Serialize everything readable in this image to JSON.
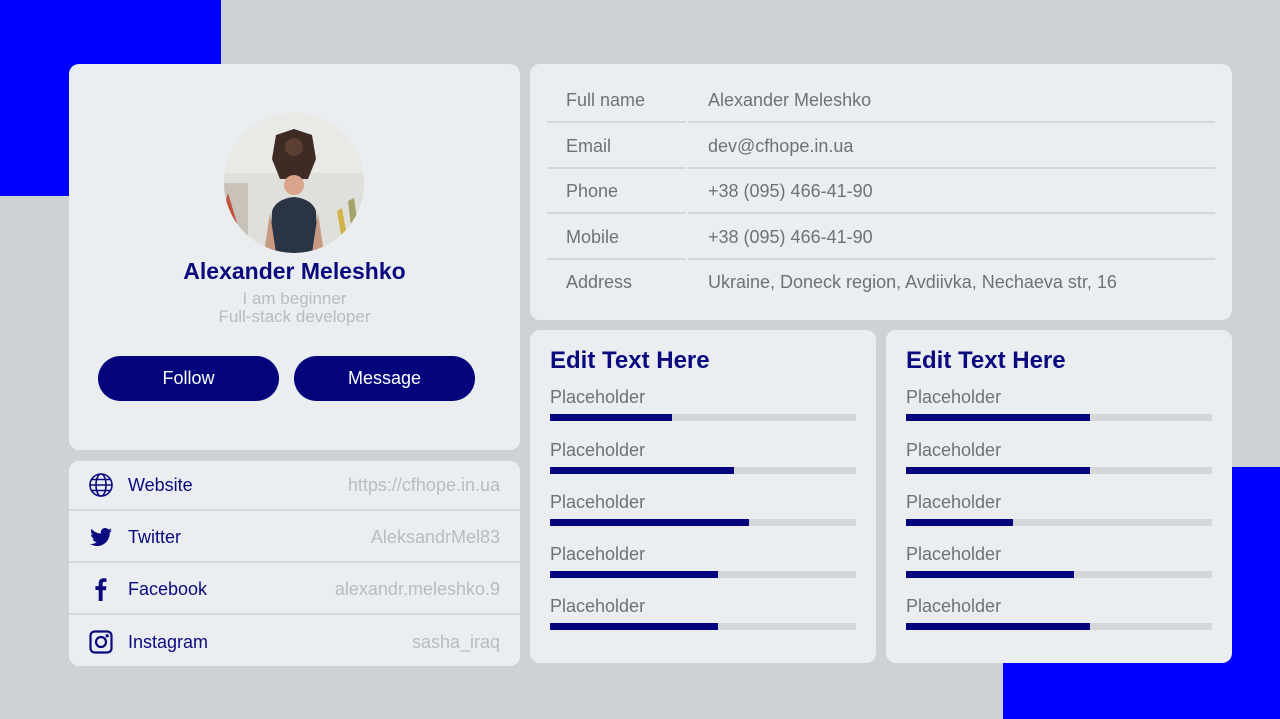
{
  "colors": {
    "accent_blue": "#0000fe",
    "navy": "#04047c",
    "card_bg": "#ebeef0",
    "page_bg": "#ced2d4",
    "muted_text": "#b9bcbe",
    "body_text": "#6f7275"
  },
  "profile": {
    "avatar_icon": "profile-photo",
    "name": "Alexander Meleshko",
    "subtitle_line1": "I am beginner",
    "subtitle_line2": "Full-stack developer",
    "follow_label": "Follow",
    "message_label": "Message"
  },
  "social": [
    {
      "icon": "globe-icon",
      "label": "Website",
      "value": "https://cfhope.in.ua"
    },
    {
      "icon": "twitter-icon",
      "label": "Twitter",
      "value": "AleksandrMel83"
    },
    {
      "icon": "facebook-icon",
      "label": "Facebook",
      "value": "alexandr.meleshko.9"
    },
    {
      "icon": "instagram-icon",
      "label": "Instagram",
      "value": "sasha_iraq"
    }
  ],
  "info": [
    {
      "key": "Full name",
      "value": "Alexander Meleshko"
    },
    {
      "key": "Email",
      "value": "dev@cfhope.in.ua"
    },
    {
      "key": "Phone",
      "value": "+38 (095) 466-41-90"
    },
    {
      "key": "Mobile",
      "value": "+38 (095) 466-41-90"
    },
    {
      "key": "Address",
      "value": "Ukraine, Doneck region, Avdiivka, Nechaeva str, 16"
    }
  ],
  "skills_left": {
    "title": "Edit Text Here",
    "items": [
      {
        "label": "Placeholder",
        "progress": 0.4
      },
      {
        "label": "Placeholder",
        "progress": 0.6
      },
      {
        "label": "Placeholder",
        "progress": 0.65
      },
      {
        "label": "Placeholder",
        "progress": 0.55
      },
      {
        "label": "Placeholder",
        "progress": 0.55
      }
    ]
  },
  "skills_right": {
    "title": "Edit Text Here",
    "items": [
      {
        "label": "Placeholder",
        "progress": 0.6
      },
      {
        "label": "Placeholder",
        "progress": 0.6
      },
      {
        "label": "Placeholder",
        "progress": 0.35
      },
      {
        "label": "Placeholder",
        "progress": 0.55
      },
      {
        "label": "Placeholder",
        "progress": 0.6
      }
    ]
  }
}
